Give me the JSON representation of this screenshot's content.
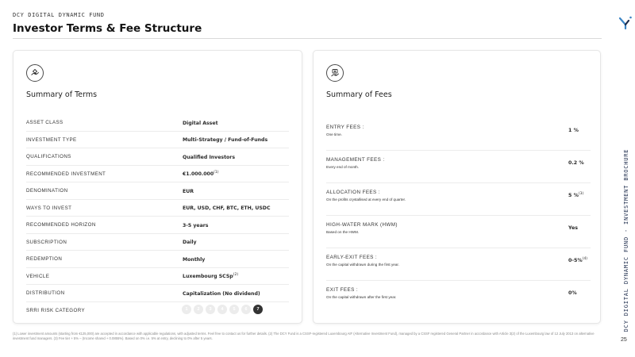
{
  "header": {
    "kicker": "DCY DIGITAL DYNAMIC FUND",
    "title": "Investor Terms & Fee Structure"
  },
  "side": {
    "vertical_text": "DCY DIGITAL DYNAMIC FUND - INVESTMENT BROCHURE",
    "page_number": "25"
  },
  "terms": {
    "icon": "hand-coin-icon",
    "title": "Summary of Terms",
    "rows": [
      {
        "label": "ASSET CLASS",
        "value": "Digital Asset",
        "sup": ""
      },
      {
        "label": "INVESTMENT TYPE",
        "value": "Multi-Strategy / Fund-of-Funds",
        "sup": ""
      },
      {
        "label": "QUALIFICATIONS",
        "value": "Qualified Investors",
        "sup": ""
      },
      {
        "label": "RECOMMENDED INVESTMENT",
        "value": "€1.000.000",
        "sup": "(1)"
      },
      {
        "label": "DENOMINATION",
        "value": "EUR",
        "sup": ""
      },
      {
        "label": "WAYS TO INVEST",
        "value": "EUR, USD, CHF, BTC, ETH, USDC",
        "sup": ""
      },
      {
        "label": "RECOMMENDED HORIZON",
        "value": "3-5 years",
        "sup": ""
      },
      {
        "label": "SUBSCRIPTION",
        "value": "Daily",
        "sup": ""
      },
      {
        "label": "REDEMPTION",
        "value": "Monthly",
        "sup": ""
      },
      {
        "label": "VEHICLE",
        "value": "Luxembourg SCSp",
        "sup": "(2)"
      },
      {
        "label": "DISTRIBUTION",
        "value": "Capitalization (No dividend)",
        "sup": ""
      }
    ],
    "srri": {
      "label": "SRRI RISK CATEGORY",
      "levels": [
        "1",
        "2",
        "3",
        "4",
        "5",
        "6",
        "7"
      ],
      "selected": "7"
    }
  },
  "fees": {
    "icon": "money-hand-icon",
    "title": "Summary of Fees",
    "rows": [
      {
        "label": "ENTRY FEES :",
        "desc": "One time.",
        "value": "1 %",
        "sup": ""
      },
      {
        "label": "MANAGEMENT FEES :",
        "desc": "Every end of month.",
        "value": "0.2 %",
        "sup": ""
      },
      {
        "label": "ALLOCATION FEES :",
        "desc": "On the profits crystallised at every end of quarter.",
        "value": "5 %",
        "sup": "(3)"
      },
      {
        "label": "HIGH-WATER MARK (HWM)",
        "desc": "Based on the HWM.",
        "value": "Yes",
        "sup": ""
      },
      {
        "label": "EARLY-EXIT FEES :",
        "desc": "On the capital withdrawn during the first year.",
        "value": "0-5%",
        "sup": "(4)"
      },
      {
        "label": "EXIT FEES :",
        "desc": "On the capital withdrawn after the first year.",
        "value": "0%",
        "sup": ""
      }
    ]
  },
  "footnote": "(1) Lower investment amounts (starting from €125,000) are accepted in accordance with applicable regulations, with adjusted terms. Feel free to contact us for further details. (2) The DCY Fund is a CSSF-registered Luxembourg AIF (Alternative Investment Fund), managed by a CSSF registered General Partner in accordance with Article 3(2) of the Luxembourg law of 12 July 2013 on alternative investment fund managers. (3) Fee tier + 5% – (Income shared + 0.0855%). Based on 0% i.e. 5% at entry, declining to 0% after 5 years."
}
